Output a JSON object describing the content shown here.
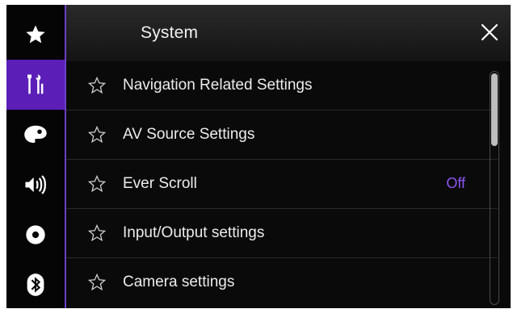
{
  "header": {
    "title": "System"
  },
  "sidebar": {
    "items": [
      {
        "icon": "star-icon",
        "active": false
      },
      {
        "icon": "settings-tools-icon",
        "active": true
      },
      {
        "icon": "palette-icon",
        "active": false
      },
      {
        "icon": "speaker-icon",
        "active": false
      },
      {
        "icon": "disc-icon",
        "active": false
      },
      {
        "icon": "bluetooth-icon",
        "active": false
      }
    ]
  },
  "menu": {
    "items": [
      {
        "label": "Navigation Related Settings",
        "value": ""
      },
      {
        "label": "AV Source Settings",
        "value": ""
      },
      {
        "label": "Ever Scroll",
        "value": "Off"
      },
      {
        "label": "Input/Output settings",
        "value": ""
      },
      {
        "label": "Camera settings",
        "value": ""
      }
    ]
  },
  "colors": {
    "accent": "#5b1fb8",
    "value_text": "#8a55f0",
    "background": "#0a0a0a"
  }
}
